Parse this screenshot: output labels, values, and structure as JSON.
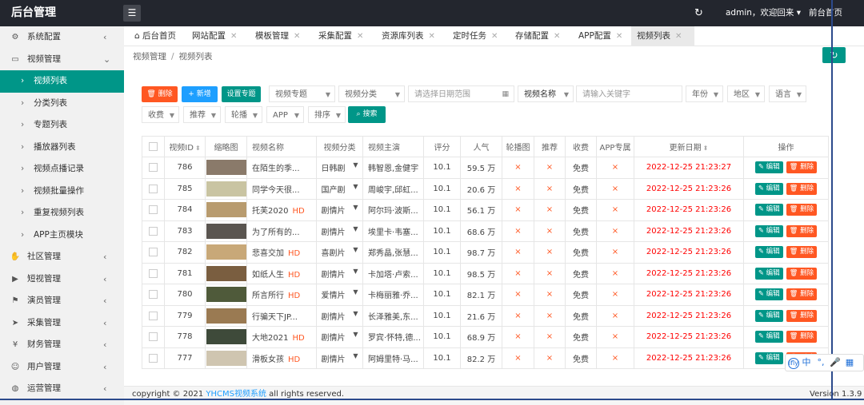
{
  "header": {
    "brand": "后台管理",
    "menu_toggle_icon": "menu-fold-icon",
    "user_menu": "admin，欢迎回来 ▾",
    "front_link": "前台首页"
  },
  "sidebar": {
    "groups_top": [
      {
        "icon": "gear-icon",
        "label": "系统配置",
        "arrow": "‹"
      },
      {
        "icon": "video-icon",
        "label": "视频管理",
        "arrow": "⌄"
      }
    ],
    "sub_items": [
      {
        "label": "视频列表",
        "active": true
      },
      {
        "label": "分类列表"
      },
      {
        "label": "专题列表"
      },
      {
        "label": "播放器列表"
      },
      {
        "label": "视频点播记录"
      },
      {
        "label": "视频批量操作"
      },
      {
        "label": "重复视频列表"
      },
      {
        "label": "APP主页模块"
      }
    ],
    "groups_bottom": [
      {
        "icon": "community-icon",
        "label": "社区管理"
      },
      {
        "icon": "play-circle-icon",
        "label": "短视管理"
      },
      {
        "icon": "flag-icon",
        "label": "演员管理"
      },
      {
        "icon": "send-icon",
        "label": "采集管理"
      },
      {
        "icon": "yen-icon",
        "label": "财务管理"
      },
      {
        "icon": "user-icon",
        "label": "用户管理"
      },
      {
        "icon": "globe-icon",
        "label": "运营管理"
      }
    ]
  },
  "tabs": [
    {
      "label": "后台首页",
      "home": true
    },
    {
      "label": "网站配置"
    },
    {
      "label": "模板管理"
    },
    {
      "label": "采集配置"
    },
    {
      "label": "资源库列表"
    },
    {
      "label": "定时任务"
    },
    {
      "label": "存储配置"
    },
    {
      "label": "APP配置"
    },
    {
      "label": "视频列表",
      "active": true
    }
  ],
  "breadcrumb": [
    "视频管理",
    "视频列表"
  ],
  "toolbar": {
    "delete": "🗑 删除",
    "add": "+ 新增",
    "topic": "设置专题"
  },
  "filters": {
    "topic": "视频专题",
    "category": "视频分类",
    "date_placeholder": "请选择日期范围",
    "name": "视频名称",
    "keyword_placeholder": "请输入关键字",
    "year": "年份",
    "region": "地区",
    "language": "语言",
    "charge": "收费",
    "recommend": "推荐",
    "carousel": "轮播",
    "app": "APP",
    "sort": "排序",
    "search": "搜索"
  },
  "table": {
    "headers": [
      "视频ID",
      "缩略图",
      "视频名称",
      "视频分类",
      "视频主演",
      "评分",
      "人气",
      "轮播图",
      "推荐",
      "收费",
      "APP专属",
      "更新日期",
      "操作"
    ],
    "edit_label": "✎ 编辑",
    "delete_label": "🗑 删除",
    "rows": [
      {
        "id": "786",
        "name": "在陌生的季...",
        "hd": "",
        "cat": "日韩剧",
        "cast": "韩智恩,金健宇",
        "score": "10.1",
        "pop": "59.5 万",
        "carousel": "×",
        "rec": "×",
        "charge": "免费",
        "app": "×",
        "date": "2022-12-25 21:23:27",
        "thumb": "#8a7a6a"
      },
      {
        "id": "785",
        "name": "同学今天很...",
        "hd": "",
        "cat": "国产剧",
        "cast": "周峻宇,邱虹...",
        "score": "10.1",
        "pop": "20.6 万",
        "carousel": "×",
        "rec": "×",
        "charge": "免费",
        "app": "×",
        "date": "2022-12-25 21:23:26",
        "thumb": "#c9c4a2"
      },
      {
        "id": "784",
        "name": "托芙2020",
        "hd": "HD",
        "cat": "剧情片",
        "cast": "阿尔玛·波斯...",
        "score": "10.1",
        "pop": "56.1 万",
        "carousel": "×",
        "rec": "×",
        "charge": "免费",
        "app": "×",
        "date": "2022-12-25 21:23:26",
        "thumb": "#b89b6e"
      },
      {
        "id": "783",
        "name": "为了所有的...",
        "hd": "",
        "cat": "剧情片",
        "cast": "埃里卡·韦塞...",
        "score": "10.1",
        "pop": "68.6 万",
        "carousel": "×",
        "rec": "×",
        "charge": "免费",
        "app": "×",
        "date": "2022-12-25 21:23:26",
        "thumb": "#5a5550"
      },
      {
        "id": "782",
        "name": "悲喜交加",
        "hd": "HD",
        "cat": "喜剧片",
        "cast": "郑秀晶,张慧...",
        "score": "10.1",
        "pop": "98.7 万",
        "carousel": "×",
        "rec": "×",
        "charge": "免费",
        "app": "×",
        "date": "2022-12-25 21:23:26",
        "thumb": "#c8a878"
      },
      {
        "id": "781",
        "name": "如纸人生",
        "hd": "HD",
        "cat": "剧情片",
        "cast": "卡加塔·卢索...",
        "score": "10.1",
        "pop": "98.5 万",
        "carousel": "×",
        "rec": "×",
        "charge": "免费",
        "app": "×",
        "date": "2022-12-25 21:23:26",
        "thumb": "#7a5e40"
      },
      {
        "id": "780",
        "name": "所言所行",
        "hd": "HD",
        "cat": "爱情片",
        "cast": "卡梅丽雅·乔...",
        "score": "10.1",
        "pop": "82.1 万",
        "carousel": "×",
        "rec": "×",
        "charge": "免费",
        "app": "×",
        "date": "2022-12-25 21:23:26",
        "thumb": "#4f5a3a"
      },
      {
        "id": "779",
        "name": "行骗天下JP...",
        "hd": "",
        "cat": "剧情片",
        "cast": "长泽雅美,东...",
        "score": "10.1",
        "pop": "21.6 万",
        "carousel": "×",
        "rec": "×",
        "charge": "免费",
        "app": "×",
        "date": "2022-12-25 21:23:26",
        "thumb": "#9a7a52"
      },
      {
        "id": "778",
        "name": "大地2021",
        "hd": "HD",
        "cat": "剧情片",
        "cast": "罗宾·怀特,德...",
        "score": "10.1",
        "pop": "68.9 万",
        "carousel": "×",
        "rec": "×",
        "charge": "免费",
        "app": "×",
        "date": "2022-12-25 21:23:26",
        "thumb": "#3e4a3a"
      },
      {
        "id": "777",
        "name": "滑板女孩",
        "hd": "HD",
        "cat": "剧情片",
        "cast": "阿姆里特·马...",
        "score": "10.1",
        "pop": "82.2 万",
        "carousel": "×",
        "rec": "×",
        "charge": "免费",
        "app": "×",
        "date": "2022-12-25 21:23:26",
        "thumb": "#cfc5b0"
      }
    ]
  },
  "footer": {
    "copy_prefix": "copyright © 2021 ",
    "brand": "YHCMS视频系统",
    "copy_suffix": " all rights reserved.",
    "version": "Version 1.3.9"
  },
  "ime": [
    "中",
    "°,",
    "🎤",
    "▦"
  ]
}
